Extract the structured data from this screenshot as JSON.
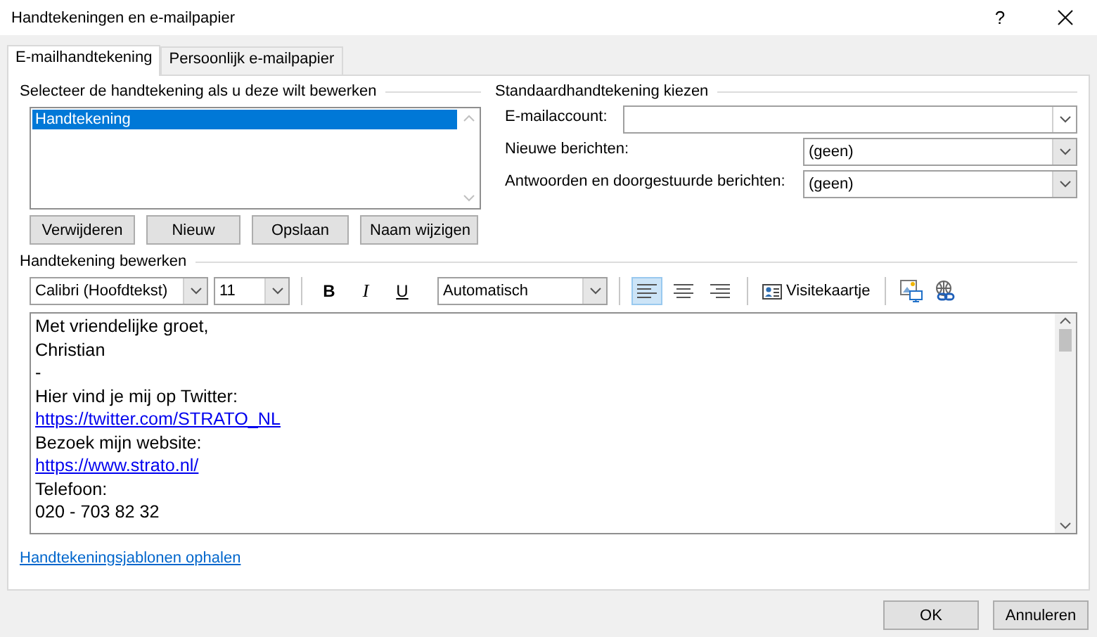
{
  "window": {
    "title": "Handtekeningen en e-mailpapier",
    "help": "?"
  },
  "tabs": [
    {
      "label": "E-mailhandtekening",
      "selected": true
    },
    {
      "label": "Persoonlijk e-mailpapier",
      "selected": false
    }
  ],
  "select_group": {
    "title": "Selecteer de handtekening als u deze wilt bewerken",
    "items": [
      {
        "label": "Handtekening",
        "selected": true
      }
    ],
    "buttons": [
      "Verwijderen",
      "Nieuw",
      "Opslaan",
      "Naam wijzigen"
    ]
  },
  "default_group": {
    "title": "Standaardhandtekening kiezen",
    "fields": [
      {
        "kind": "wide",
        "label": "E-mailaccount:"
      },
      {
        "kind": "narrow",
        "label": "Nieuwe berichten:",
        "value": "(geen)"
      },
      {
        "kind": "narrow",
        "label": "Antwoorden en doorgestuurde berichten:",
        "value": "(geen)"
      }
    ]
  },
  "editor": {
    "title": "Handtekening bewerken",
    "font": "Calibri (Hoofdtekst)",
    "size": "11",
    "styles": [
      {
        "kind": "bold",
        "label": "B"
      },
      {
        "kind": "italic",
        "label": "I"
      },
      {
        "kind": "underline",
        "label": "U"
      }
    ],
    "text_color": "Automatisch",
    "align": [
      {
        "kind": "left",
        "selected": true
      },
      {
        "kind": "center",
        "selected": false
      },
      {
        "kind": "right",
        "selected": false
      }
    ],
    "business_card": "Visitekaartje",
    "lines": [
      {
        "kind": "text",
        "text": "Met vriendelijke groet,"
      },
      {
        "kind": "text",
        "text": "Christian"
      },
      {
        "kind": "text",
        "text": "-"
      },
      {
        "kind": "text",
        "text": "Hier vind je mij op Twitter:"
      },
      {
        "kind": "link",
        "text": "https://twitter.com/STRATO_NL"
      },
      {
        "kind": "text",
        "text": "Bezoek mijn website:"
      },
      {
        "kind": "link",
        "text": "https://www.strato.nl/"
      },
      {
        "kind": "text",
        "text": "Telefoon:"
      },
      {
        "kind": "text",
        "text": "020 - 703 82 32"
      }
    ]
  },
  "template_link": "Handtekeningsjablonen ophalen",
  "buttons": [
    "OK",
    "Annuleren"
  ]
}
